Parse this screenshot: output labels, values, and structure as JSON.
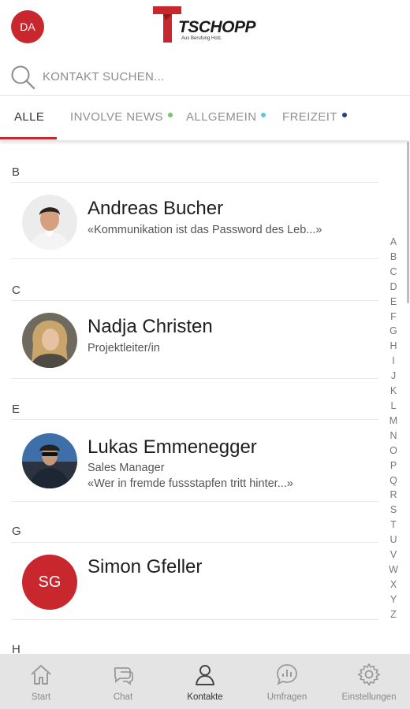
{
  "header": {
    "user_initials": "DA",
    "logo_text": "TSCHOPP",
    "logo_tagline": "Aus Berufung Holz."
  },
  "search": {
    "placeholder": "KONTAKT SUCHEN..."
  },
  "tabs": [
    {
      "label": "ALLE",
      "active": true
    },
    {
      "label": "INVOLVE NEWS",
      "dot_color": "#7cc16f"
    },
    {
      "label": "ALLGEMEIN",
      "dot_color": "#5cc7e0"
    },
    {
      "label": "FREIZEIT",
      "dot_color": "#2e3a8c"
    }
  ],
  "sections": [
    {
      "letter": "B",
      "contacts": [
        {
          "name": "Andreas Bucher",
          "lines": [
            "«Kommunikation ist das Password des Leb...»"
          ]
        }
      ]
    },
    {
      "letter": "C",
      "contacts": [
        {
          "name": "Nadja Christen",
          "lines": [
            "Projektleiter/in"
          ]
        }
      ]
    },
    {
      "letter": "E",
      "contacts": [
        {
          "name": "Lukas Emmenegger",
          "lines": [
            "Sales Manager",
            "«Wer in fremde fussstapfen tritt hinter...»"
          ]
        }
      ]
    },
    {
      "letter": "G",
      "contacts": [
        {
          "name": "Simon Gfeller",
          "initials": "SG",
          "lines": []
        }
      ]
    },
    {
      "letter": "H",
      "contacts": []
    }
  ],
  "alphabet": [
    "A",
    "B",
    "C",
    "D",
    "E",
    "F",
    "G",
    "H",
    "I",
    "J",
    "K",
    "L",
    "M",
    "N",
    "O",
    "P",
    "Q",
    "R",
    "S",
    "T",
    "U",
    "V",
    "W",
    "X",
    "Y",
    "Z"
  ],
  "bottom_nav": [
    {
      "label": "Start",
      "icon": "home-icon"
    },
    {
      "label": "Chat",
      "icon": "chat-icon"
    },
    {
      "label": "Kontakte",
      "icon": "contacts-icon",
      "active": true
    },
    {
      "label": "Umfragen",
      "icon": "survey-icon"
    },
    {
      "label": "Einstellungen",
      "icon": "gear-icon"
    }
  ],
  "colors": {
    "accent": "#c8282d",
    "nav_background": "#e4e4e4"
  }
}
